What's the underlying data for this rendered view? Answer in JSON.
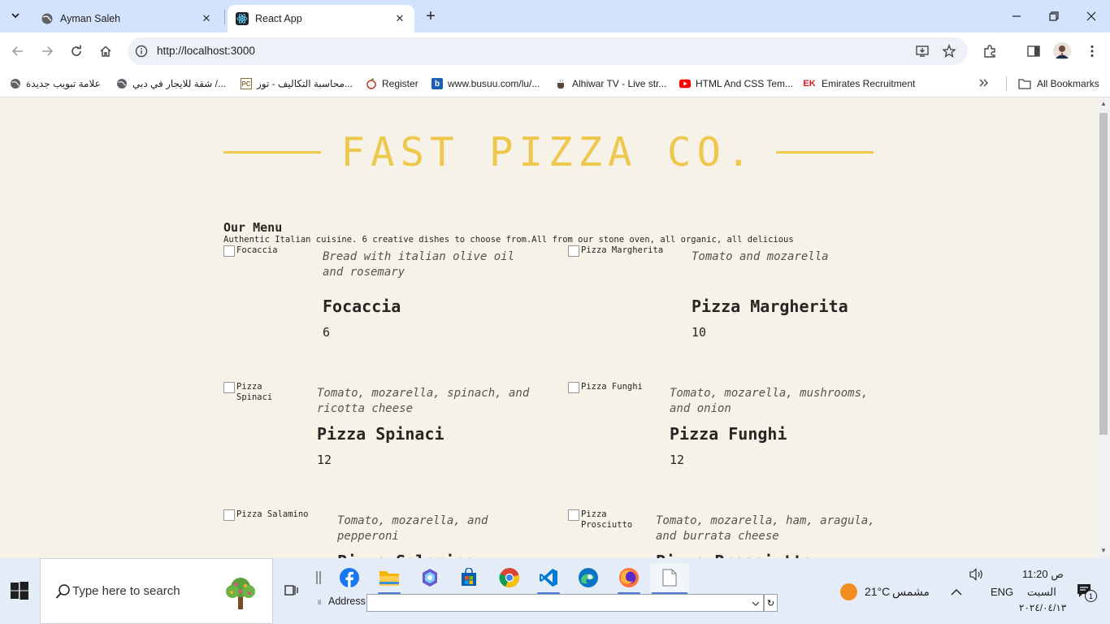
{
  "browser": {
    "tabs": [
      {
        "title": "Ayman Saleh",
        "active": false
      },
      {
        "title": "React App",
        "active": true
      }
    ],
    "url": "http://localhost:3000",
    "bookmarks": [
      {
        "label": "علامة تبويب جديدة",
        "icon": "globe-icon"
      },
      {
        "label": "شقة للايجار في دبي /...",
        "icon": "globe-icon"
      },
      {
        "label": "محاسبة التكاليف - توز...",
        "icon": "pc-icon"
      },
      {
        "label": "Register",
        "icon": "apple-icon"
      },
      {
        "label": "www.busuu.com/lu/...",
        "icon": "busuu-icon"
      },
      {
        "label": "Alhiwar TV - Live str...",
        "icon": "cup-icon"
      },
      {
        "label": "HTML And CSS Tem...",
        "icon": "youtube-icon"
      },
      {
        "label": "Emirates Recruitment",
        "icon": "ek-icon"
      }
    ],
    "all_bookmarks": "All Bookmarks",
    "colors": {
      "tabstrip": "#d3e3fd",
      "accent": "#edc84d"
    }
  },
  "page": {
    "header": "FAST PIZZA CO.",
    "menu_title": "Our Menu",
    "menu_description": "Authentic Italian cuisine. 6 creative dishes to choose from.All from our stone oven, all organic, all delicious",
    "pizzas": [
      {
        "alt": "Focaccia",
        "ingredients": "Bread with italian olive oil and rosemary",
        "name": "Focaccia",
        "price": "6"
      },
      {
        "alt": "Pizza Margherita",
        "ingredients": "Tomato and mozarella",
        "name": "Pizza Margherita",
        "price": "10"
      },
      {
        "alt": "Pizza Spinaci",
        "ingredients": "Tomato, mozarella, spinach, and ricotta cheese",
        "name": "Pizza Spinaci",
        "price": "12"
      },
      {
        "alt": "Pizza Funghi",
        "ingredients": "Tomato, mozarella, mushrooms, and onion",
        "name": "Pizza Funghi",
        "price": "12"
      },
      {
        "alt": "Pizza Salamino",
        "ingredients": "Tomato, mozarella, and pepperoni",
        "name": "Pizza Salamino",
        "price": ""
      },
      {
        "alt": "Pizza Prosciutto",
        "ingredients": "Tomato, mozarella, ham, aragula, and burrata cheese",
        "name": "Pizza Prosciutto",
        "price": ""
      }
    ]
  },
  "taskbar": {
    "search_placeholder": "Type here to search",
    "address_label": "Address",
    "weather_temp": "21°C",
    "weather_desc": "مشمس",
    "language": "ENG",
    "time": "11:20 ص",
    "day": "السبت",
    "date": "٢٠٢٤/٠٤/١٣",
    "notification_count": "1"
  }
}
